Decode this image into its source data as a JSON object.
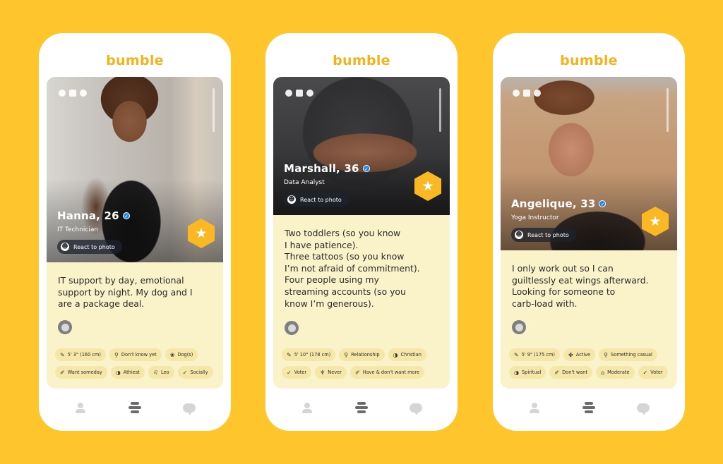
{
  "brand": {
    "logo": "bumble",
    "accent_color": "#FEC62C",
    "logo_color": "#F4B21C"
  },
  "profiles": [
    {
      "name_age": "Hanna, 26",
      "verified": true,
      "job": "IT Technician",
      "react_label": "React to photo",
      "social_icons": [
        "quote-icon",
        "instagram-icon",
        "spotify-icon"
      ],
      "bio": "IT support by day, emotional\nsupport by night. My dog and I\nare a package deal.",
      "tags": [
        {
          "icon": "ruler-icon",
          "glyph": "✎",
          "label": "5' 3\" (160 cm)"
        },
        {
          "icon": "search-icon",
          "glyph": "⚲",
          "label": "Don't know yet"
        },
        {
          "icon": "paw-icon",
          "glyph": "❀",
          "label": "Dog(s)"
        },
        {
          "icon": "pacifier-icon",
          "glyph": "✐",
          "label": "Want someday"
        },
        {
          "icon": "religion-icon",
          "glyph": "◑",
          "label": "Athiest"
        },
        {
          "icon": "zodiac-icon",
          "glyph": "♌",
          "label": "Leo"
        },
        {
          "icon": "drink-icon",
          "glyph": "✓",
          "label": "Socially"
        }
      ]
    },
    {
      "name_age": "Marshall, 36",
      "verified": true,
      "job": "Data Analyst",
      "react_label": "React to photo",
      "social_icons": [
        "quote-icon",
        "instagram-icon",
        "spotify-icon"
      ],
      "bio": "Two toddlers (so you know\nI have patience).\nThree tattoos (so you know\nI’m not afraid of commitment).\nFour people using my\nstreaming accounts (so you\nknow I’m generous).",
      "tags": [
        {
          "icon": "ruler-icon",
          "glyph": "✎",
          "label": "5' 10\" (178 cm)"
        },
        {
          "icon": "search-icon",
          "glyph": "⚲",
          "label": "Relationship"
        },
        {
          "icon": "religion-icon",
          "glyph": "◑",
          "label": "Christian"
        },
        {
          "icon": "vote-icon",
          "glyph": "✓",
          "label": "Voter"
        },
        {
          "icon": "glass-icon",
          "glyph": "♆",
          "label": "Never"
        },
        {
          "icon": "pacifier-icon",
          "glyph": "✐",
          "label": "Have & don't want more"
        }
      ]
    },
    {
      "name_age": "Angelique, 33",
      "verified": true,
      "job": "Yoga Instructor",
      "react_label": "React to photo",
      "social_icons": [
        "quote-icon",
        "instagram-icon",
        "spotify-icon"
      ],
      "bio": "I only work out so I can\nguiltlessly eat wings afterward.\nLooking for someone to\ncarb-load with.",
      "tags": [
        {
          "icon": "ruler-icon",
          "glyph": "✎",
          "label": "5' 9\" (175 cm)"
        },
        {
          "icon": "exercise-icon",
          "glyph": "✤",
          "label": "Active"
        },
        {
          "icon": "search-icon",
          "glyph": "⚲",
          "label": "Something casual"
        },
        {
          "icon": "religion-icon",
          "glyph": "◑",
          "label": "Spiritual"
        },
        {
          "icon": "pacifier-icon",
          "glyph": "✐",
          "label": "Don't want"
        },
        {
          "icon": "politics-icon",
          "glyph": "⌂",
          "label": "Moderate"
        },
        {
          "icon": "vote-icon",
          "glyph": "✓",
          "label": "Voter"
        }
      ]
    }
  ],
  "tabbar": {
    "items": [
      {
        "name": "profile",
        "active": false
      },
      {
        "name": "hive",
        "active": true
      },
      {
        "name": "chats",
        "active": false
      }
    ]
  }
}
